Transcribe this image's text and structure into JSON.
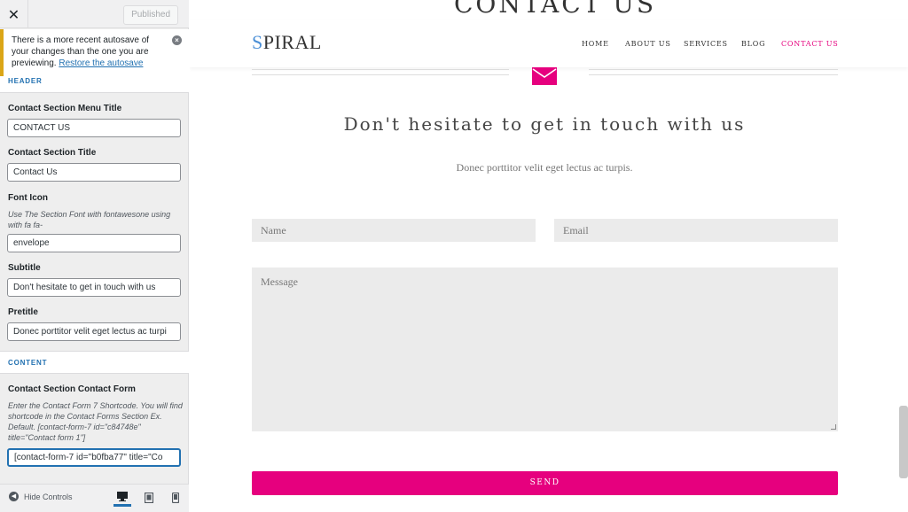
{
  "customizer": {
    "close_icon": "close-icon",
    "published_label": "Published",
    "notice": {
      "text": "There is a more recent autosave of your changes than the one you are previewing.",
      "link": "Restore the autosave"
    },
    "section_header": "HEADER",
    "fields": {
      "menu_title_label": "Contact Section Menu Title",
      "menu_title_value": "CONTACT US",
      "title_label": "Contact Section Title",
      "title_value": "Contact Us",
      "font_icon_label": "Font Icon",
      "font_icon_desc": "Use The Section Font with fontawesone using with fa fa-",
      "font_icon_value": "envelope",
      "subtitle_label": "Subtitle",
      "subtitle_value": "Don't hesitate to get in touch with us",
      "pretitle_label": "Pretitle",
      "pretitle_value": "Donec porttitor velit eget lectus ac turpi"
    },
    "content_header": "CONTENT",
    "contact_form": {
      "label": "Contact Section Contact Form",
      "desc": "Enter the Contact Form 7 Shortcode. You will find shortcode in the Contact Forms Section Ex. Default. [contact-form-7 id=\"c84748e\" title=\"Contact form 1\"]",
      "value": "[contact-form-7 id=\"b0fba77\" title=\"Co"
    },
    "hide_controls_label": "Hide Controls",
    "devices": [
      "desktop-icon",
      "tablet-icon",
      "mobile-icon"
    ]
  },
  "preview": {
    "bg_section_title": "CONTACT US",
    "logo_first": "S",
    "logo_rest": "PIRAL",
    "nav": [
      "HOME",
      "ABOUT US",
      "SERVICES",
      "BLOG",
      "CONTACT US"
    ],
    "active_nav": "CONTACT US",
    "headline": "Don't hesitate to get in touch with us",
    "pretitle": "Donec porttitor velit eget lectus ac turpis.",
    "form": {
      "name_placeholder": "Name",
      "email_placeholder": "Email",
      "message_placeholder": "Message",
      "send_label": "SEND"
    },
    "colors": {
      "accent": "#e6007e",
      "logo_accent": "#4b8fd6",
      "notice_border": "#dba617",
      "link": "#2271b1"
    }
  }
}
